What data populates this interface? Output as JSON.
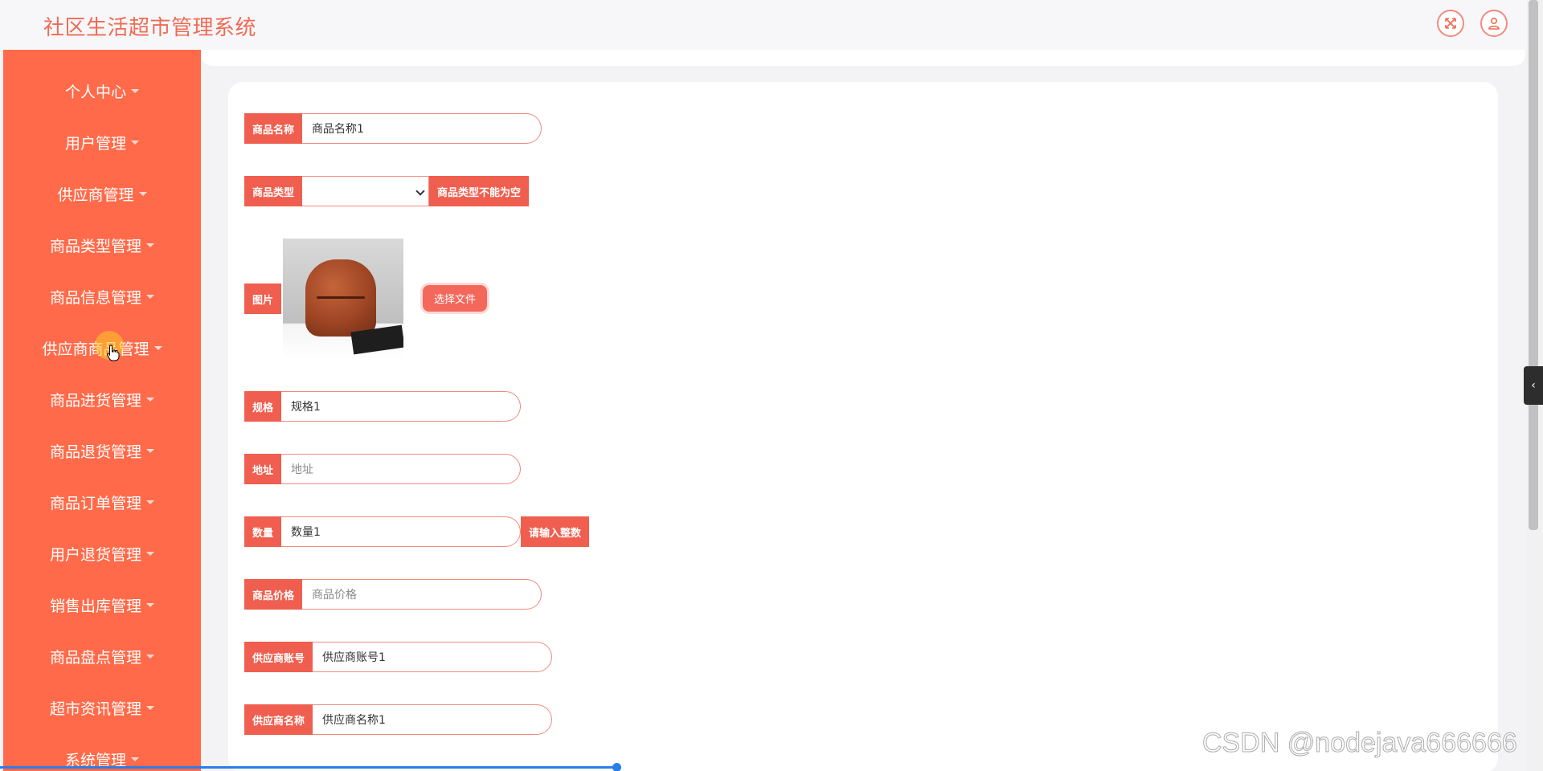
{
  "app": {
    "title": "社区生活超市管理系统"
  },
  "header": {
    "icons": [
      "fullscreen-icon",
      "user-icon"
    ]
  },
  "sidebar": {
    "items": [
      {
        "label": "个人中心"
      },
      {
        "label": "用户管理"
      },
      {
        "label": "供应商管理"
      },
      {
        "label": "商品类型管理"
      },
      {
        "label": "商品信息管理"
      },
      {
        "label": "供应商商品管理"
      },
      {
        "label": "商品进货管理"
      },
      {
        "label": "商品退货管理"
      },
      {
        "label": "商品订单管理"
      },
      {
        "label": "用户退货管理"
      },
      {
        "label": "销售出库管理"
      },
      {
        "label": "商品盘点管理"
      },
      {
        "label": "超市资讯管理"
      },
      {
        "label": "系统管理"
      }
    ]
  },
  "form": {
    "product_name": {
      "label": "商品名称",
      "value": "商品名称1"
    },
    "product_type": {
      "label": "商品类型",
      "value": "",
      "error": "商品类型不能为空"
    },
    "image": {
      "label": "图片",
      "button": "选择文件"
    },
    "spec": {
      "label": "规格",
      "value": "规格1"
    },
    "address": {
      "label": "地址",
      "placeholder": "地址"
    },
    "quantity": {
      "label": "数量",
      "value": "数量1",
      "error": "请输入整数"
    },
    "price": {
      "label": "商品价格",
      "placeholder": "商品价格"
    },
    "supplier_account": {
      "label": "供应商账号",
      "value": "供应商账号1"
    },
    "supplier_name": {
      "label": "供应商名称",
      "value": "供应商名称1"
    }
  },
  "watermark": "CSDN @nodejava666666",
  "colors": {
    "accent": "#ff6b4a",
    "label": "#ef5e4e",
    "title": "#ef6b55"
  }
}
